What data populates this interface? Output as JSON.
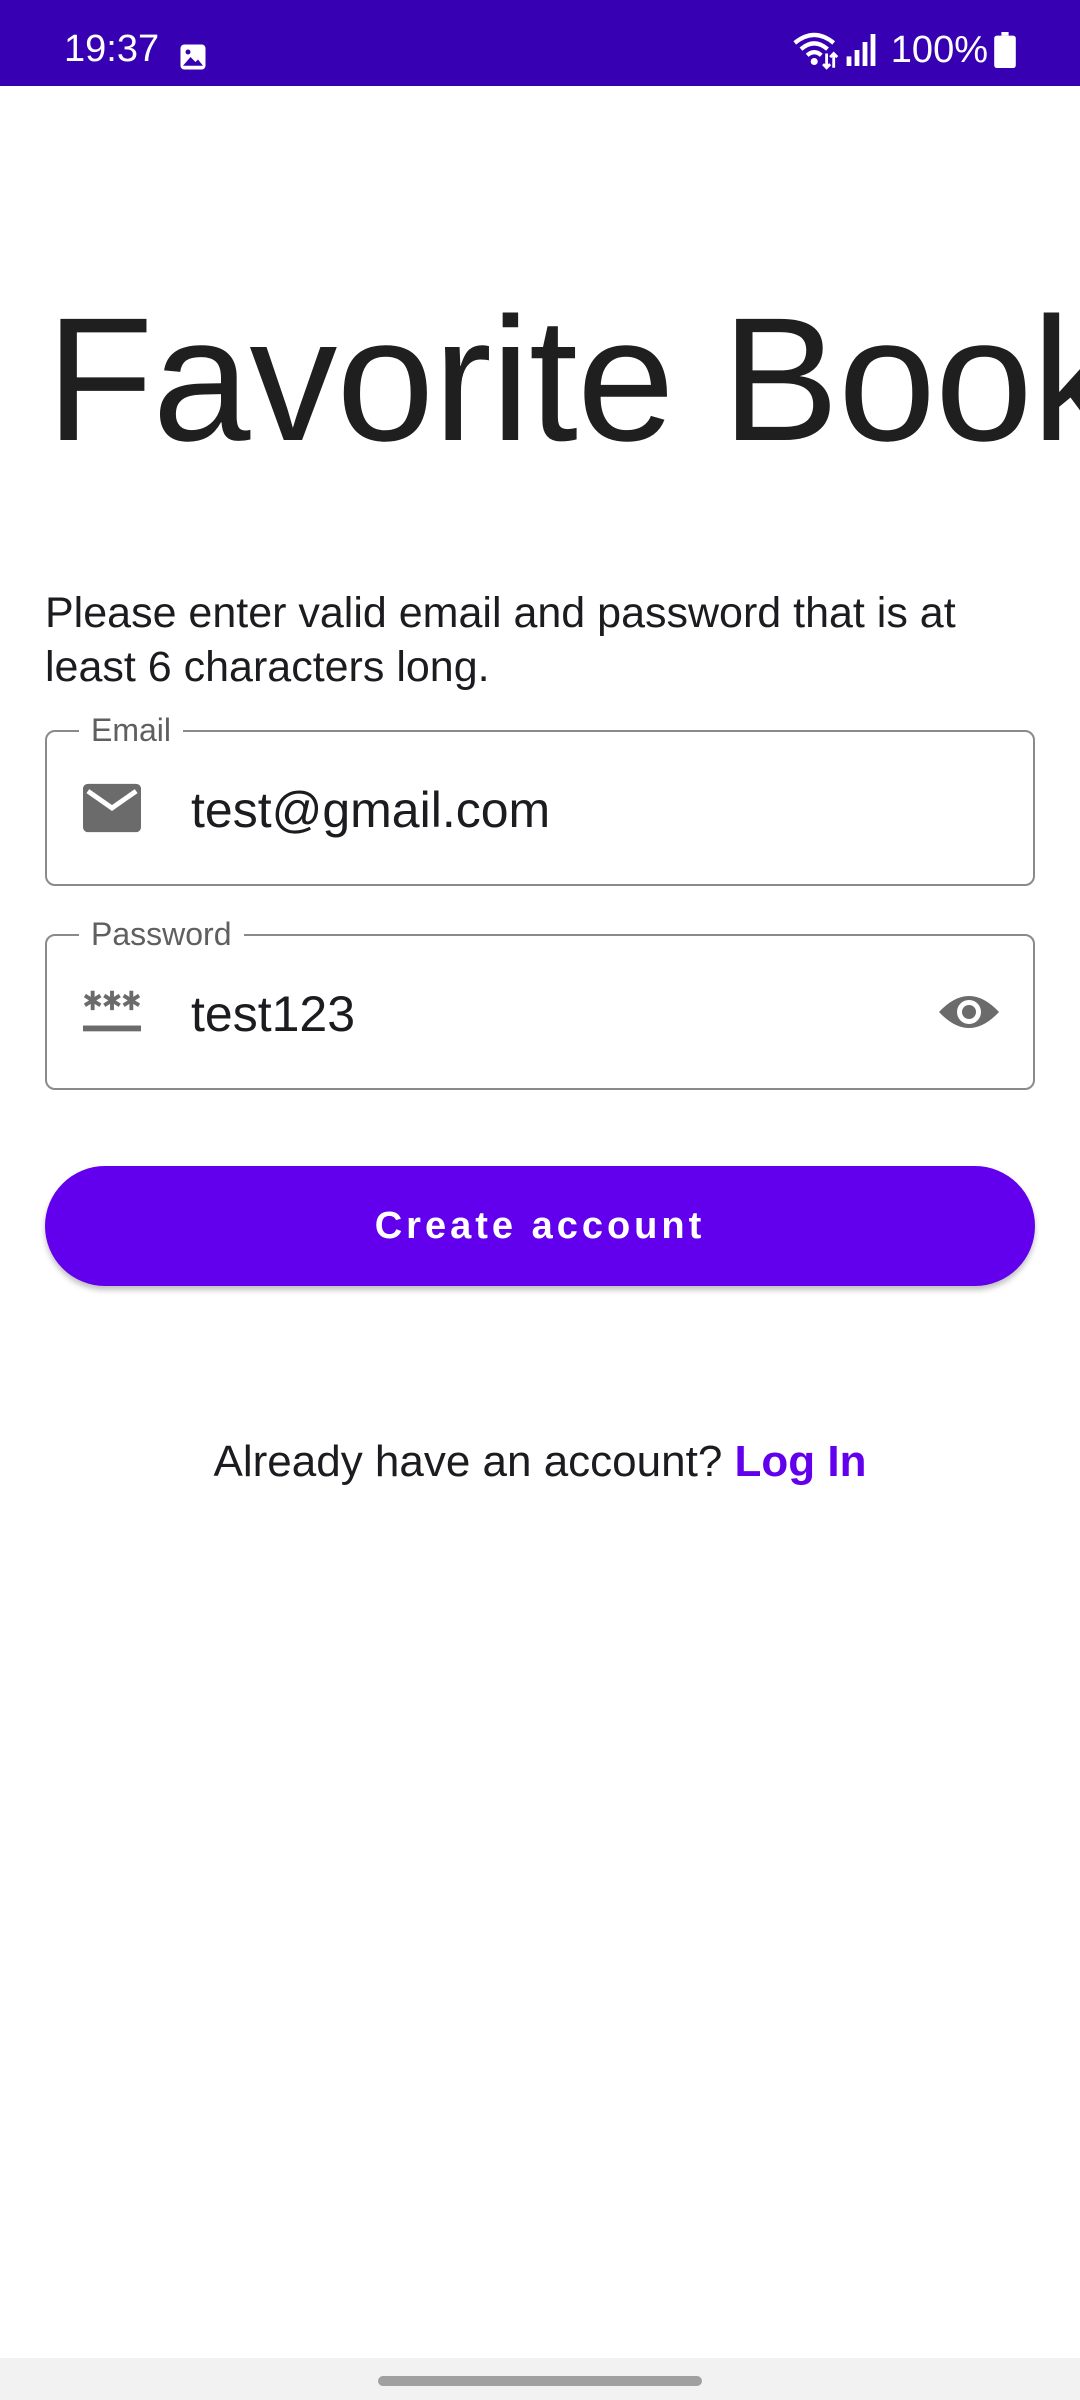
{
  "status_bar": {
    "time": "19:37",
    "battery": "100%",
    "icons": [
      "image-icon",
      "wifi-icon",
      "signal-icon",
      "battery-icon"
    ]
  },
  "app": {
    "title": "Favorite Book",
    "instructions": "Please enter valid email and password that is at least 6 characters long."
  },
  "email_field": {
    "label": "Email",
    "value": "test@gmail.com",
    "icon": "mail-icon"
  },
  "password_field": {
    "label": "Password",
    "value": "test123",
    "icon": "password-icon",
    "trailing_icon": "eye-icon"
  },
  "create_button": {
    "label": "Create account"
  },
  "login": {
    "prompt": "Already have an account? ",
    "link": "Log In"
  },
  "colors": {
    "status_bar": "#3700b3",
    "primary": "#6200ee",
    "outline": "#8a8a8a"
  }
}
